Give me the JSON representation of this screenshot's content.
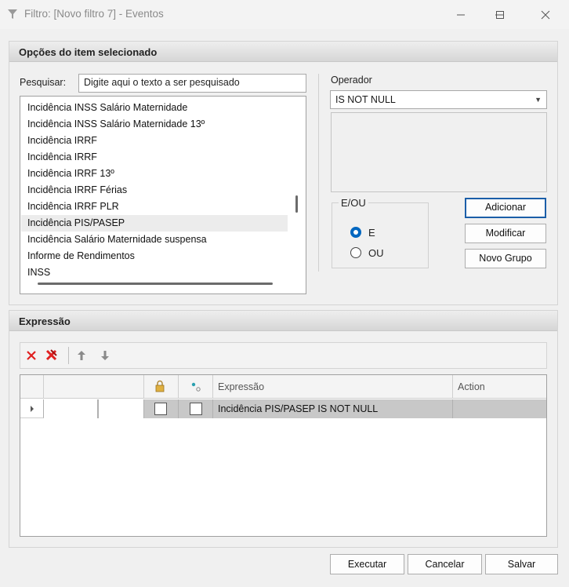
{
  "window": {
    "title": "Filtro: [Novo filtro 7] - Eventos",
    "minimize": "—",
    "maximize": "☐",
    "close": "✕"
  },
  "options_panel": {
    "title": "Opções do item selecionado",
    "search_label": "Pesquisar:",
    "search_placeholder": "Digite aqui o texto a ser pesquisado",
    "list_items": [
      "Incidência INSS Salário Maternidade",
      "Incidência INSS Salário Maternidade 13º",
      "Incidência IRRF",
      "Incidência IRRF",
      "Incidência IRRF 13º",
      "Incidência IRRF Férias",
      "Incidência IRRF PLR",
      "Incidência PIS/PASEP",
      "Incidência Salário Maternidade suspensa",
      "Informe de Rendimentos",
      "INSS"
    ],
    "selected_index": 7,
    "operator_label": "Operador",
    "operator_value": "IS NOT NULL",
    "eou": {
      "title": "E/OU",
      "options": [
        "E",
        "OU"
      ],
      "selected": "E"
    },
    "buttons": {
      "add": "Adicionar",
      "modify": "Modificar",
      "new_group": "Novo Grupo"
    }
  },
  "expression_panel": {
    "title": "Expressão",
    "toolbar_icons": [
      "delete-icon",
      "delete-all-icon",
      "move-up-icon",
      "move-down-icon"
    ],
    "columns": [
      "",
      "",
      "",
      "Expressão",
      "Action"
    ],
    "rows": [
      {
        "locked": false,
        "linked": false,
        "expression": "Incidência PIS/PASEP IS NOT NULL",
        "action": ""
      }
    ]
  },
  "footer": {
    "execute": "Executar",
    "cancel": "Cancelar",
    "save": "Salvar"
  },
  "colors": {
    "accent": "#0067c0",
    "delete_red": "#e02020",
    "selected_row": "#c8c8c8"
  }
}
